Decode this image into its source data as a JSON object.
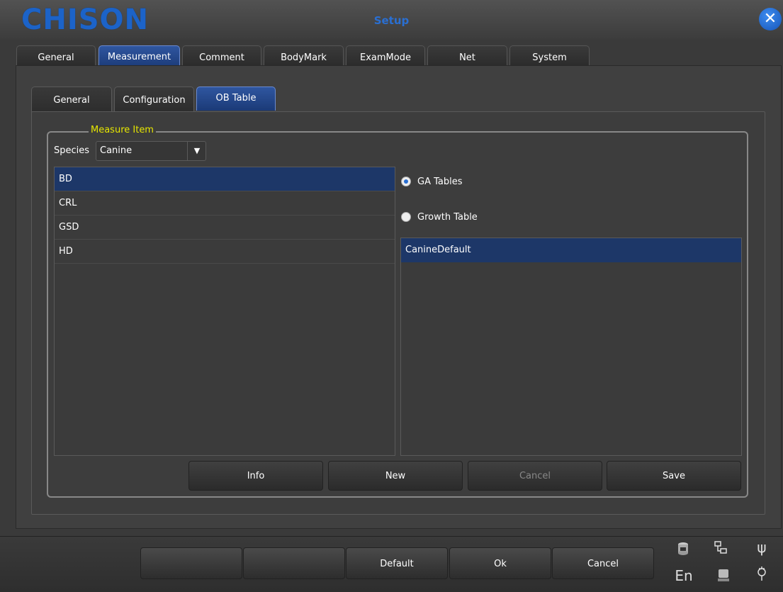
{
  "brand": "CHISON",
  "window_title": "Setup",
  "main_tabs": [
    {
      "label": "General"
    },
    {
      "label": "Measurement"
    },
    {
      "label": "Comment"
    },
    {
      "label": "BodyMark"
    },
    {
      "label": "ExamMode"
    },
    {
      "label": "Net"
    },
    {
      "label": "System"
    }
  ],
  "active_main_tab": "Measurement",
  "sub_tabs": [
    {
      "label": "General"
    },
    {
      "label": "Configuration"
    },
    {
      "label": "OB Table"
    }
  ],
  "active_sub_tab": "OB Table",
  "measure_group": {
    "title": "Measure Item",
    "species_label": "Species",
    "species_value": "Canine",
    "items": [
      "BD",
      "CRL",
      "GSD",
      "HD"
    ],
    "selected_item": "BD"
  },
  "table_type": {
    "options": [
      {
        "label": "GA Tables",
        "selected": true
      },
      {
        "label": "Growth Table",
        "selected": false
      }
    ]
  },
  "tables": {
    "items": [
      "CanineDefault"
    ],
    "selected": "CanineDefault"
  },
  "actions": {
    "info": "Info",
    "new": "New",
    "cancel": "Cancel",
    "save": "Save"
  },
  "footer": {
    "blank1": "",
    "blank2": "",
    "default": "Default",
    "ok": "Ok",
    "cancel": "Cancel",
    "lang": "En"
  },
  "icons": [
    "database-icon",
    "network-icon",
    "usb-icon",
    "storage-icon",
    "power-plug-icon"
  ],
  "colors": {
    "accent": "#1d3768",
    "tab_active": "#2a4f95",
    "group_title": "#e6e600",
    "brand": "#1c63c8"
  }
}
